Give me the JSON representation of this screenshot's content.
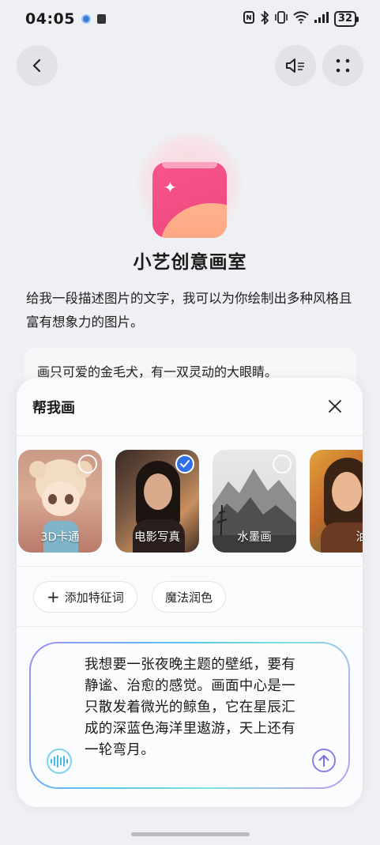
{
  "status_bar": {
    "time": "04:05",
    "battery": "32",
    "icons": [
      "nfc-icon",
      "bluetooth-icon",
      "vibrate-icon",
      "wifi-icon",
      "signal-icon"
    ]
  },
  "header": {
    "back_icon": "chevron-left-icon",
    "sound_icon": "speaker-mute-icon",
    "more_icon": "grid-dots-icon"
  },
  "app": {
    "logo_icon": "sparkle-card-icon",
    "title": "小艺创意画室",
    "description": "给我一段描述图片的文字，我可以为你绘制出多种风格且富有想象力的图片。",
    "example_prompt": "画只可爱的金毛犬，有一双灵动的大眼睛。"
  },
  "sheet": {
    "title": "帮我画",
    "close_icon": "close-icon",
    "styles": [
      {
        "label": "3D卡通",
        "selected": false
      },
      {
        "label": "电影写真",
        "selected": true
      },
      {
        "label": "水墨画",
        "selected": false
      },
      {
        "label": "油画",
        "selected": false
      }
    ],
    "chips": [
      {
        "label": "添加特征词",
        "icon": "plus-icon"
      },
      {
        "label": "魔法润色"
      }
    ],
    "input_text": "我想要一张夜晚主题的壁纸，要有静谧、治愈的感觉。画面中心是一只散发着微光的鲸鱼，它在星辰汇成的深蓝色海洋里遨游，天上还有一轮弯月。",
    "voice_icon": "voice-wave-icon",
    "send_icon": "arrow-up-icon"
  },
  "colors": {
    "accent_blue": "#2f6fe8",
    "logo_pink": "#f0457e",
    "gradient_border": [
      "#9e8cf5",
      "#54c7f0",
      "#c49af5"
    ]
  }
}
